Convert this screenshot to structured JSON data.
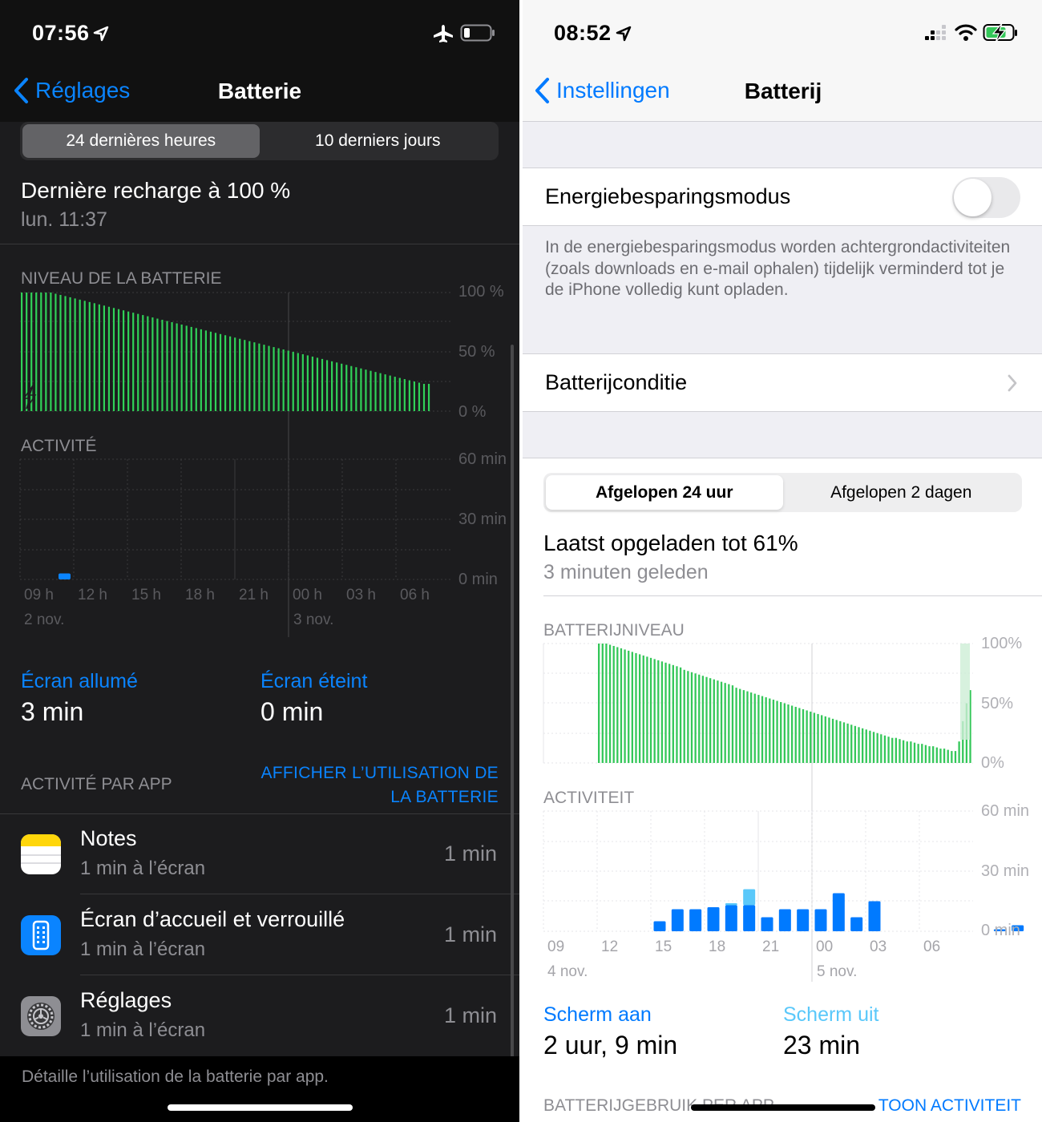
{
  "left": {
    "status": {
      "time": "07:56"
    },
    "nav": {
      "back": "Réglages",
      "title": "Batterie"
    },
    "segment": [
      "24 dernières heures",
      "10 derniers jours"
    ],
    "last_charge": {
      "title": "Dernière recharge à 100 %",
      "when": "lun. 11:37"
    },
    "battery_section": "NIVEAU DE LA BATTERIE",
    "battery_yticks": [
      "100 %",
      "50 %",
      "0 %"
    ],
    "activity_section": "ACTIVITÉ",
    "activity_yticks": [
      "60 min",
      "30 min",
      "0 min"
    ],
    "xticks": [
      "09 h",
      "12 h",
      "15 h",
      "18 h",
      "21 h",
      "00 h",
      "03 h",
      "06 h"
    ],
    "dates": [
      "2 nov.",
      "3 nov."
    ],
    "screen_on": {
      "label": "Écran allumé",
      "value": "3 min"
    },
    "screen_off": {
      "label": "Écran éteint",
      "value": "0 min"
    },
    "apps_section": "ACTIVITÉ PAR APP",
    "show_usage": "AFFICHER L’UTILISATION DE LA BATTERIE",
    "apps": [
      {
        "name": "Notes",
        "sub": "1 min à l’écran",
        "value": "1 min",
        "icon": "notes-icon"
      },
      {
        "name": "Écran d’accueil et verrouillé",
        "sub": "1 min à l’écran",
        "value": "1 min",
        "icon": "home-lock-screen-icon"
      },
      {
        "name": "Réglages",
        "sub": "1 min à l’écran",
        "value": "1 min",
        "icon": "settings-icon"
      }
    ],
    "footer": "Détaille l’utilisation de la batterie par app.",
    "colors": {
      "accent": "#0a84ff",
      "battery": "#30d158"
    }
  },
  "right": {
    "status": {
      "time": "08:52"
    },
    "nav": {
      "back": "Instellingen",
      "title": "Batterij"
    },
    "low_power": {
      "label": "Energiebesparingsmodus",
      "enabled": false
    },
    "low_power_desc": "In de energiebesparingsmodus worden achtergrondactiviteiten (zoals downloads en e-mail ophalen) tijdelijk verminderd tot je de iPhone volledig kunt opladen.",
    "battery_health": "Batterijconditie",
    "segment": [
      "Afgelopen 24 uur",
      "Afgelopen 2 dagen"
    ],
    "last_charge": {
      "title": "Laatst opgeladen tot 61%",
      "when": "3 minuten geleden"
    },
    "battery_section": "BATTERIJNIVEAU",
    "battery_yticks": [
      "100%",
      "50%",
      "0%"
    ],
    "activity_section": "ACTIVITEIT",
    "activity_yticks": [
      "60 min",
      "30 min",
      "0 min"
    ],
    "xticks": [
      "09",
      "12",
      "15",
      "18",
      "21",
      "00",
      "03",
      "06"
    ],
    "dates": [
      "4 nov.",
      "5 nov."
    ],
    "screen_on": {
      "label": "Scherm aan",
      "value": "2 uur, 9 min"
    },
    "screen_off": {
      "label": "Scherm uit",
      "value": "23 min"
    },
    "apps_section": "BATTERIJGEBRUIK PER APP",
    "show_activity": "TOON ACTIVITEIT",
    "colors": {
      "accent": "#007aff",
      "battery": "#34c759"
    }
  },
  "chart_data": [
    {
      "type": "bar",
      "title": "NIVEAU DE LA BATTERIE",
      "ylim": [
        0,
        100
      ],
      "unit": "%",
      "x_range": [
        "09 h",
        "06 h"
      ],
      "values": [
        100,
        100,
        100,
        100,
        100,
        100,
        100,
        99,
        98,
        97,
        96,
        95,
        94,
        93,
        92,
        91,
        90,
        89,
        88,
        87,
        86,
        85,
        84,
        83,
        82,
        81,
        80,
        79,
        78,
        77,
        76,
        75,
        74,
        73,
        72,
        71,
        70,
        69,
        68,
        67,
        66,
        65,
        64,
        63,
        62,
        61,
        60,
        59,
        58,
        57,
        56,
        55,
        54,
        53,
        52,
        51,
        50,
        49,
        48,
        47,
        46,
        45,
        44,
        43,
        42,
        41,
        40,
        39,
        38,
        37,
        36,
        35,
        34,
        33,
        32,
        31,
        30,
        29,
        28,
        27,
        26,
        25,
        24,
        23,
        23
      ]
    },
    {
      "type": "bar",
      "title": "ACTIVITÉ",
      "ylim": [
        0,
        60
      ],
      "unit": "min",
      "categories": [
        "09 h",
        "12 h",
        "15 h",
        "18 h",
        "21 h",
        "00 h",
        "03 h",
        "06 h"
      ],
      "values": [
        3,
        0,
        0,
        0,
        0,
        0,
        0,
        0
      ]
    },
    {
      "type": "bar",
      "title": "BATTERIJNIVEAU",
      "ylim": [
        0,
        100
      ],
      "unit": "%",
      "x_range": [
        "09",
        "06"
      ],
      "values": [
        100,
        100,
        100,
        99,
        98,
        97,
        96,
        95,
        94,
        93,
        92,
        91,
        90,
        89,
        88,
        87,
        86,
        85,
        84,
        83,
        82,
        81,
        80,
        78,
        77,
        76,
        75,
        74,
        73,
        72,
        71,
        70,
        69,
        68,
        67,
        66,
        65,
        63,
        62,
        61,
        60,
        59,
        58,
        57,
        56,
        55,
        54,
        53,
        52,
        51,
        50,
        49,
        48,
        47,
        46,
        45,
        44,
        43,
        42,
        41,
        40,
        39,
        38,
        37,
        36,
        35,
        34,
        33,
        32,
        31,
        30,
        29,
        28,
        27,
        26,
        25,
        24,
        23,
        22,
        21,
        21,
        20,
        19,
        18,
        18,
        17,
        16,
        16,
        15,
        14,
        14,
        13,
        12,
        12,
        11,
        10,
        10,
        18,
        35,
        50,
        61
      ]
    },
    {
      "type": "bar",
      "title": "ACTIVITEIT",
      "ylim": [
        0,
        60
      ],
      "unit": "min",
      "categories": [
        "09",
        "10",
        "11",
        "12",
        "13",
        "14",
        "15",
        "16",
        "17",
        "18",
        "19",
        "20",
        "21",
        "22",
        "23",
        "00",
        "01",
        "02",
        "03",
        "04",
        "05",
        "06",
        "07",
        "08"
      ],
      "series": [
        {
          "values": [
            0,
            0,
            0,
            5,
            11,
            11,
            12,
            13,
            13,
            7,
            11,
            11,
            11,
            19,
            7,
            15,
            0,
            0,
            0,
            0,
            0,
            0,
            1,
            3
          ]
        },
        {
          "values": [
            0,
            0,
            0,
            0,
            0,
            0,
            0,
            1,
            8,
            0,
            0,
            0,
            0,
            0,
            0,
            0,
            0,
            0,
            0,
            0,
            0,
            0,
            0,
            0
          ]
        }
      ]
    }
  ]
}
